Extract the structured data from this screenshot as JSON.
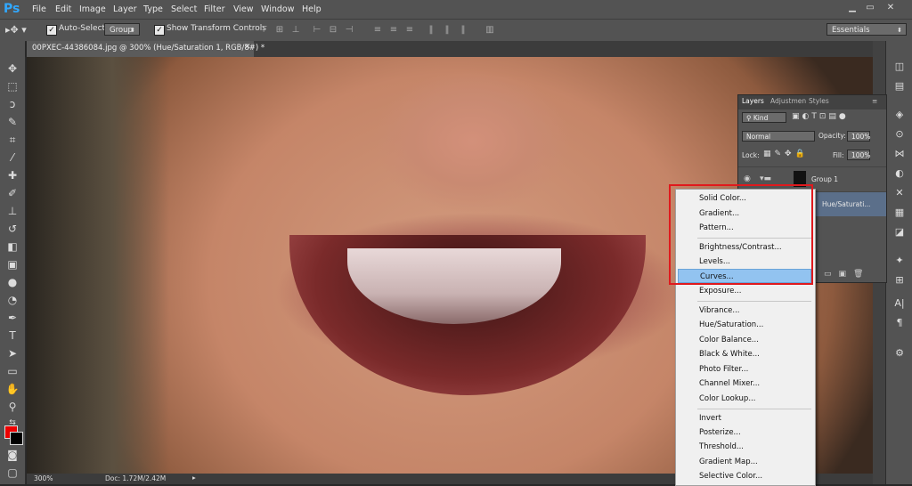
{
  "app": {
    "logo": "Ps",
    "menu": [
      "File",
      "Edit",
      "Image",
      "Layer",
      "Type",
      "Select",
      "Filter",
      "View",
      "Window",
      "Help"
    ]
  },
  "options": {
    "auto_select_label": "Auto-Select:",
    "auto_select_checked": true,
    "target_value": "Group",
    "show_transform_label": "Show Transform Controls",
    "show_transform_checked": true,
    "workspace": "Essentials"
  },
  "document": {
    "tab_title": "00PXEC-44386084.jpg @ 300% (Hue/Saturation 1, RGB/8#) *",
    "zoom": "300%",
    "doc_size": "Doc: 1.72M/2.42M"
  },
  "colors": {
    "foreground": "#e00000",
    "background": "#000000",
    "accent": "#e0191d"
  },
  "layers_panel": {
    "tabs": [
      "Layers",
      "Adjustmen",
      "Styles"
    ],
    "filter_kind": "Kind",
    "blend_mode": "Normal",
    "opacity_label": "Opacity:",
    "opacity_value": "100%",
    "lock_label": "Lock:",
    "fill_label": "Fill:",
    "fill_value": "100%",
    "layers": [
      "Group 1",
      "Hue/Saturati..."
    ]
  },
  "context_menu": {
    "items": [
      "Solid Color...",
      "Gradient...",
      "Pattern...",
      "Brightness/Contrast...",
      "Levels...",
      "Curves...",
      "Exposure...",
      "Vibrance...",
      "Hue/Saturation...",
      "Color Balance...",
      "Black & White...",
      "Photo Filter...",
      "Channel Mixer...",
      "Color Lookup...",
      "Invert",
      "Posterize...",
      "Threshold...",
      "Gradient Map...",
      "Selective Color..."
    ],
    "highlighted": "Curves..."
  }
}
